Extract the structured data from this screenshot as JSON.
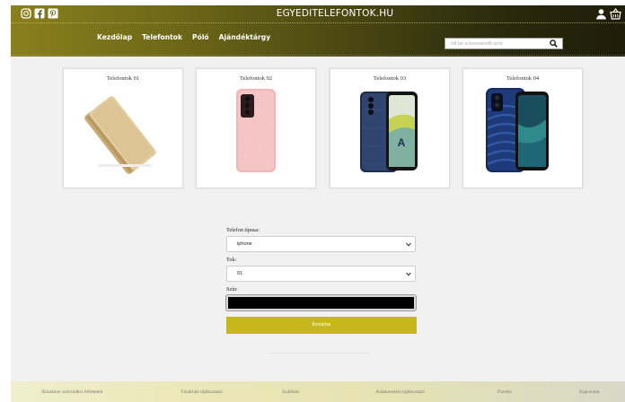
{
  "header": {
    "site_title": "EGYEDITELEFONTOK.HU",
    "social_icons": [
      "instagram-icon",
      "facebook-icon",
      "pinterest-icon"
    ],
    "user_icons": [
      "user-icon",
      "cart-icon"
    ],
    "nav": [
      "Kezdőlap",
      "Telefontok",
      "Póló",
      "Ajándéktárgy"
    ],
    "search": {
      "placeholder": "Írd be a keresendő szót",
      "value": ""
    }
  },
  "products": [
    {
      "title": "Telefontok 01",
      "color": "#d8c293",
      "style": "folio-gold"
    },
    {
      "title": "Telefontok 02",
      "color": "#f0b9ba",
      "style": "pink-glitter"
    },
    {
      "title": "Telefontok 03",
      "color": "#2b3f63",
      "style": "navy-leather"
    },
    {
      "title": "Telefontok 04",
      "color": "#1f3a7a",
      "style": "blue-ribbed"
    }
  ],
  "form": {
    "phone_type_label": "Telefon típusa:",
    "phone_type_value": "iphone",
    "case_label": "Tok:",
    "case_value": "01",
    "color_label": "Szín:",
    "color_value": "#000000",
    "submit_label": "Kosárba"
  },
  "footer": {
    "links": [
      "Általános szerződési feltételek",
      "Vásárlási tájékoztató",
      "Szállítás",
      "Adatkezelési tájékoztató",
      "Fizetés",
      "Kapcsolat"
    ]
  },
  "colors": {
    "header_gradient_start": "#8a7f1d",
    "header_gradient_end": "#1e1d08",
    "accent_button": "#c7b61d",
    "main_bg": "#f1f1f1",
    "footer_bg": "#ebe7b6"
  }
}
